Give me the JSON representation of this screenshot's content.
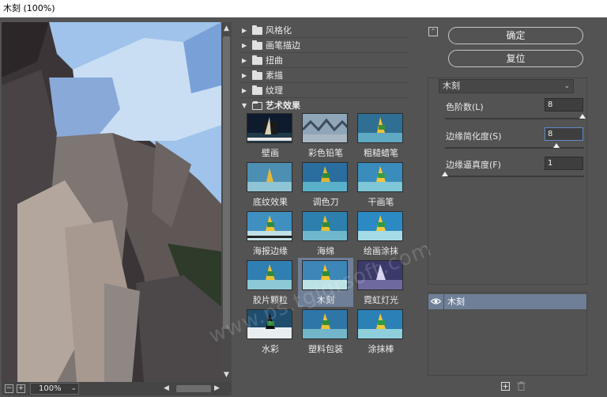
{
  "window": {
    "title": "木刻 (100%)"
  },
  "preview": {
    "zoom": "100%",
    "zoom_out_icon": "minus-square-icon",
    "zoom_in_icon": "plus-square-icon"
  },
  "categories": [
    {
      "label": "风格化",
      "expanded": false
    },
    {
      "label": "画笔描边",
      "expanded": false
    },
    {
      "label": "扭曲",
      "expanded": false
    },
    {
      "label": "素描",
      "expanded": false
    },
    {
      "label": "纹理",
      "expanded": false
    },
    {
      "label": "艺术效果",
      "expanded": true
    }
  ],
  "artistic_filters": [
    {
      "label": "壁画",
      "selected": false
    },
    {
      "label": "彩色铅笔",
      "selected": false
    },
    {
      "label": "粗糙蜡笔",
      "selected": false
    },
    {
      "label": "底纹效果",
      "selected": false
    },
    {
      "label": "调色刀",
      "selected": false
    },
    {
      "label": "干画笔",
      "selected": false
    },
    {
      "label": "海报边缘",
      "selected": false
    },
    {
      "label": "海绵",
      "selected": false
    },
    {
      "label": "绘画涂抹",
      "selected": false
    },
    {
      "label": "胶片颗粒",
      "selected": false
    },
    {
      "label": "木刻",
      "selected": true
    },
    {
      "label": "霓虹灯光",
      "selected": false
    },
    {
      "label": "水彩",
      "selected": false
    },
    {
      "label": "塑料包装",
      "selected": false
    },
    {
      "label": "涂抹棒",
      "selected": false
    }
  ],
  "watermark": "www.ps.tgjqrsoft.com",
  "buttons": {
    "ok": "确定",
    "reset": "复位"
  },
  "filter_select": {
    "value": "木刻"
  },
  "params": [
    {
      "label": "色阶数(L)",
      "value": "8",
      "slider_fraction": 0.99
    },
    {
      "label": "边缘简化度(S)",
      "value": "8",
      "slider_fraction": 0.8
    },
    {
      "label": "边缘逼真度(F)",
      "value": "1",
      "slider_fraction": 0.0
    }
  ],
  "layers": [
    {
      "label": "木刻",
      "visible": true
    }
  ],
  "colors": {
    "accent": "#6f7f97",
    "panel": "#535353",
    "focus": "#5e8bc8"
  }
}
